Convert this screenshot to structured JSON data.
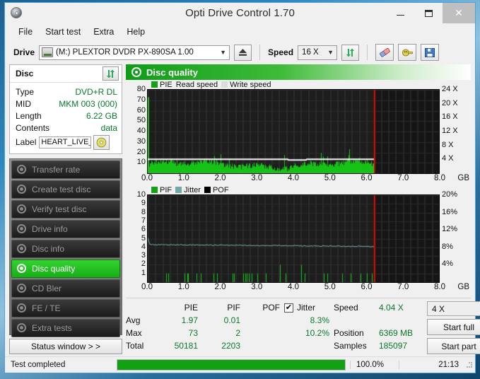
{
  "window": {
    "title": "Opti Drive Control 1.70",
    "icon": "disc-icon",
    "minimize": "–",
    "maximize": "□",
    "close": "✕"
  },
  "menubar": {
    "items": [
      "File",
      "Start test",
      "Extra",
      "Help"
    ]
  },
  "toolbar": {
    "drive_label": "Drive",
    "drive_value": "(M:)   PLEXTOR DVDR  PX-890SA 1.00",
    "eject_icon": "eject-icon",
    "speed_label": "Speed",
    "speed_value": "16 X",
    "refresh_icon": "refresh-icon",
    "erase_icon": "eraser-icon",
    "plug_icon": "plug-icon",
    "save_icon": "save-icon"
  },
  "disc_panel": {
    "title": "Disc",
    "refresh_icon": "refresh-icon",
    "rows": [
      {
        "key": "Type",
        "value": "DVD+R DL"
      },
      {
        "key": "MID",
        "value": "MKM 003 (000)"
      },
      {
        "key": "Length",
        "value": "6.22 GB"
      },
      {
        "key": "Contents",
        "value": "data"
      }
    ],
    "label_key": "Label",
    "label_value": "HEART_LIVE_A",
    "label_icon": "disc-icon"
  },
  "nav": {
    "items": [
      {
        "label": "Transfer rate",
        "active": false
      },
      {
        "label": "Create test disc",
        "active": false
      },
      {
        "label": "Verify test disc",
        "active": false
      },
      {
        "label": "Drive info",
        "active": false
      },
      {
        "label": "Disc info",
        "active": false
      },
      {
        "label": "Disc quality",
        "active": true
      },
      {
        "label": "CD Bler",
        "active": false
      },
      {
        "label": "FE / TE",
        "active": false
      },
      {
        "label": "Extra tests",
        "active": false
      }
    ],
    "status_button": "Status window > >"
  },
  "content": {
    "header": "Disc quality",
    "header_icon": "disc-quality-icon"
  },
  "chart_data": [
    {
      "type": "line",
      "title": "Disc quality - PIE / Read speed",
      "xlabel": "GB",
      "ylabel": "PIE",
      "y2label": "X",
      "xlim": [
        0,
        8.0
      ],
      "ylim": [
        0,
        80
      ],
      "y2lim": [
        0,
        24
      ],
      "grid": true,
      "legend": [
        {
          "name": "PIE",
          "color": "#14a014"
        },
        {
          "name": "Read speed",
          "color": "#ffffff"
        },
        {
          "name": "Write speed",
          "color": "#d8d8d8"
        }
      ],
      "xticks": [
        "0.0",
        "1.0",
        "2.0",
        "3.0",
        "4.0",
        "5.0",
        "6.0",
        "7.0",
        "8.0"
      ],
      "yticks": [
        "10",
        "20",
        "30",
        "40",
        "50",
        "60",
        "70",
        "80"
      ],
      "y2ticks": [
        "4 X",
        "8 X",
        "12 X",
        "16 X",
        "20 X",
        "24 X"
      ],
      "xunit": "GB",
      "data_end_gb": 6.22,
      "marker_gb": 6.22,
      "series": [
        {
          "name": "PIE",
          "note": "dense green spikes, baseline ~5-9, initial spike to 73, max 73, avg 1.97"
        },
        {
          "name": "Read speed",
          "note": "flat white line at about 4.04 X (y2), constant across recorded area"
        }
      ]
    },
    {
      "type": "line",
      "title": "Disc quality - PIF / Jitter / POF",
      "xlabel": "GB",
      "ylabel": "PIF",
      "y2label": "%",
      "xlim": [
        0,
        8.0
      ],
      "ylim": [
        0,
        10
      ],
      "y2lim": [
        0,
        20
      ],
      "grid": true,
      "legend": [
        {
          "name": "PIF",
          "color": "#14a014"
        },
        {
          "name": "Jitter",
          "color": "#74a8a8"
        },
        {
          "name": "POF",
          "color": "#000000"
        }
      ],
      "xticks": [
        "0.0",
        "1.0",
        "2.0",
        "3.0",
        "4.0",
        "5.0",
        "6.0",
        "7.0",
        "8.0"
      ],
      "yticks": [
        "1",
        "2",
        "3",
        "4",
        "5",
        "6",
        "7",
        "8",
        "9",
        "10"
      ],
      "y2ticks": [
        "4%",
        "8%",
        "12%",
        "16%",
        "20%"
      ],
      "xunit": "GB",
      "data_end_gb": 6.22,
      "marker_gb": 6.22,
      "series": [
        {
          "name": "PIF",
          "note": "sparse green spikes, mostly 1, some 2, max 2"
        },
        {
          "name": "Jitter",
          "note": "near-flat teal trace around 8.3% (y2 scale), start ~5.1, drifting from 4.3 to 4.1 (left scale)"
        }
      ]
    }
  ],
  "stats": {
    "columns": [
      "PIE",
      "PIF",
      "POF",
      "Jitter"
    ],
    "rows": [
      {
        "label": "Avg",
        "pie": "1.97",
        "pif": "0.01",
        "pof": "",
        "jitter": "8.3%"
      },
      {
        "label": "Max",
        "pie": "73",
        "pif": "2",
        "pof": "",
        "jitter": "10.2%"
      },
      {
        "label": "Total",
        "pie": "50181",
        "pif": "2203",
        "pof": "",
        "jitter": ""
      }
    ],
    "jitter_checked": true,
    "jitter_check_glyph": "✔",
    "info": [
      {
        "key": "Speed",
        "value": "4.04 X"
      },
      {
        "key": "Position",
        "value": "6369 MB"
      },
      {
        "key": "Samples",
        "value": "185097"
      }
    ],
    "test_speed": "4 X",
    "start_full": "Start full",
    "start_part": "Start part"
  },
  "statusbar": {
    "text": "Test completed",
    "percent": "100.0%",
    "progress": 100,
    "time": "21:13"
  },
  "colors": {
    "accent_green": "#14a014",
    "value_green": "#0a7a2a",
    "marker_red": "#e00000",
    "jitter_teal": "#74a8a8",
    "titlebar": "#f0f0f0",
    "window_border": "#4aa3df"
  }
}
